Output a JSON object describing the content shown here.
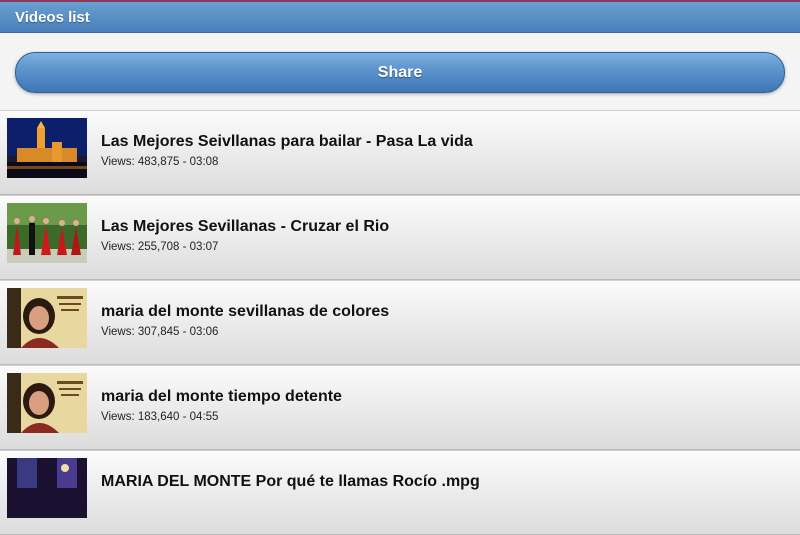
{
  "header": {
    "title": "Videos list"
  },
  "share_button": {
    "label": "Share"
  },
  "videos": [
    {
      "title": "Las Mejores Seivllanas para bailar - Pasa La vida",
      "meta": "Views: 483,875 - 03:08",
      "thumb": "cathedral-night-thumbnail"
    },
    {
      "title": "Las Mejores Sevillanas - Cruzar el Rio",
      "meta": "Views: 255,708 - 03:07",
      "thumb": "flamenco-dancers-thumbnail"
    },
    {
      "title": "maria del monte sevillanas de colores",
      "meta": "Views: 307,845 - 03:06",
      "thumb": "singer-portrait-thumbnail"
    },
    {
      "title": "maria del monte tiempo detente",
      "meta": "Views: 183,640 - 04:55",
      "thumb": "singer-portrait-thumbnail"
    },
    {
      "title": "MARIA DEL MONTE  Por qué te llamas Rocío .mpg",
      "meta": "",
      "thumb": "stage-performance-thumbnail"
    }
  ]
}
